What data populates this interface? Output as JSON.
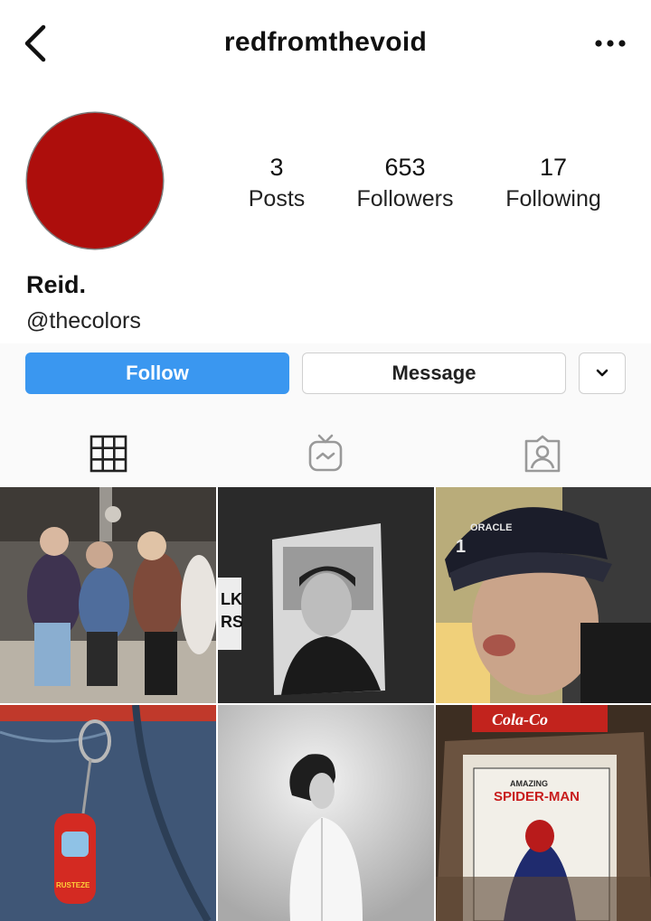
{
  "header": {
    "username": "redfromthevoid",
    "back_icon": "chevron-left-icon",
    "more_icon": "more-horizontal-icon"
  },
  "profile": {
    "avatar_color": "#ad0e0c",
    "name": "Reid.",
    "handle": "@thecolors",
    "stats": [
      {
        "value": "3",
        "label": "Posts"
      },
      {
        "value": "653",
        "label": "Followers"
      },
      {
        "value": "17",
        "label": "Following"
      }
    ]
  },
  "actions": {
    "follow_label": "Follow",
    "message_label": "Message",
    "follow_color": "#3a97f0"
  },
  "tabs": [
    {
      "icon": "grid-icon",
      "active": true
    },
    {
      "icon": "igtv-icon",
      "active": false
    },
    {
      "icon": "tagged-person-icon",
      "active": false
    }
  ],
  "posts": [
    {
      "subject": "studio-group-photo"
    },
    {
      "subject": "black-white-poster"
    },
    {
      "subject": "selfie-cap"
    },
    {
      "subject": "red-car-keychain"
    },
    {
      "subject": "bw-portrait"
    },
    {
      "subject": "comic-books"
    }
  ],
  "post_texts": {
    "poster_side_text_1": "LK",
    "poster_side_text_2": "RS",
    "cap_brand": "ORACLE",
    "cap_number": "1",
    "keychain_text": "RUSTEZE",
    "comic_brand": "Cola-Co",
    "comic_title_top": "AMAZING",
    "comic_title": "SPIDER-MAN"
  }
}
